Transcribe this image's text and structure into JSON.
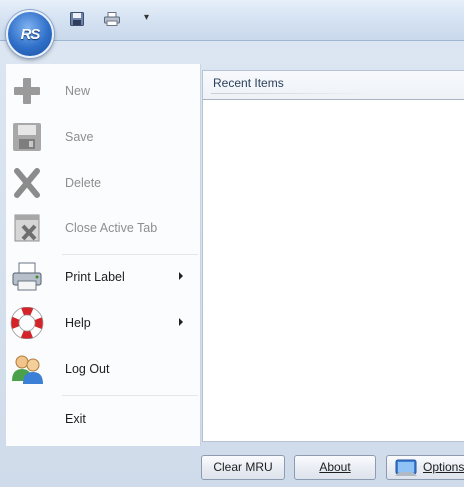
{
  "app": {
    "orb_text": "RS"
  },
  "quick_access": {
    "save_icon": "floppy-disk-icon",
    "print_icon": "printer-icon",
    "customize": "▾"
  },
  "menu": {
    "items": [
      {
        "label": "New",
        "icon": "plus-icon",
        "enabled": false,
        "has_submenu": false
      },
      {
        "label": "Save",
        "icon": "floppy-disk-icon",
        "enabled": false,
        "has_submenu": false
      },
      {
        "label": "Delete",
        "icon": "x-icon",
        "enabled": false,
        "has_submenu": false
      },
      {
        "label": "Close Active Tab",
        "icon": "close-tab-icon",
        "enabled": false,
        "has_submenu": false
      },
      {
        "label": "Print Label",
        "icon": "printer-icon",
        "enabled": true,
        "has_submenu": true
      },
      {
        "label": "Help",
        "icon": "lifebuoy-icon",
        "enabled": true,
        "has_submenu": true
      },
      {
        "label": "Log Out",
        "icon": "users-icon",
        "enabled": true,
        "has_submenu": false
      },
      {
        "label": "Exit",
        "icon": "",
        "enabled": true,
        "has_submenu": false
      }
    ]
  },
  "recent": {
    "title": "Recent Items",
    "items": []
  },
  "footer": {
    "clear_mru_label": "Clear MRU",
    "about_label": "About",
    "options_label": "Options"
  },
  "colors": {
    "ribbon_blue": "#d5e2f2",
    "orb_blue": "#2f6fc9",
    "disabled_text": "#8e8e8e"
  }
}
